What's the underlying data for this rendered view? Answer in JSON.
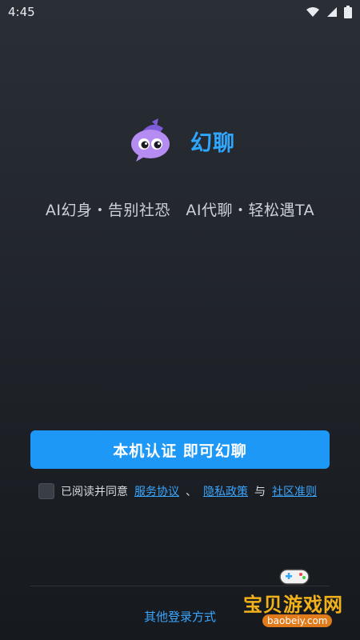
{
  "status": {
    "time": "4:45",
    "icons": [
      "wifi-icon",
      "signal-icon",
      "battery-icon"
    ]
  },
  "brand": {
    "app_name": "幻聊",
    "logo": "ghost-chat-logo"
  },
  "slogan": "AI幻身・告别社恐　AI代聊・轻松遇TA",
  "primary_button": {
    "label": "本机认证 即可幻聊"
  },
  "agreement": {
    "prefix": "已阅读并同意",
    "link1": "服务协议",
    "sep1": "、",
    "link2": "隐私政策",
    "sep2": "与",
    "link3": "社区准则",
    "checked": false
  },
  "other_login": "其他登录方式",
  "watermark": {
    "text": "宝贝游戏网",
    "url": "baobeiy.com"
  },
  "colors": {
    "accent": "#1e98f6",
    "link": "#3aa6ff",
    "brand": "#2ea7ff"
  }
}
